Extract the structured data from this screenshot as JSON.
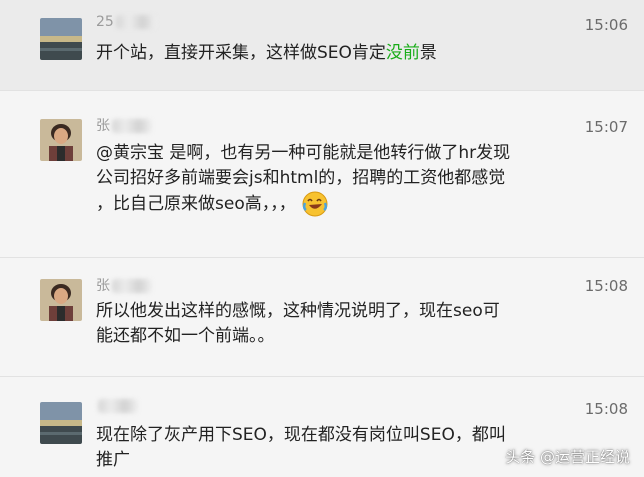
{
  "colors": {
    "highlight": "#1aad19",
    "text": "#222222",
    "meta": "#9b9b9b"
  },
  "messages": [
    {
      "sender_visible": "25",
      "time": "15:06",
      "avatar": "landscape-avatar",
      "text_a": "开个站，直接开采集，这样做SEO肯定",
      "text_highlight": "没前",
      "text_b": "景"
    },
    {
      "sender_visible": "张",
      "time": "15:07",
      "avatar": "person-avatar",
      "line1": "@黄宗宝 是啊，也有另一种可能就是他转行做了hr发现",
      "line2": "公司招好多前端要会js和html的，招聘的工资他都感觉",
      "line3": "，比自己原来做seo高，，，",
      "emoji": "laughing-crying-emoji"
    },
    {
      "sender_visible": "张",
      "time": "15:08",
      "avatar": "person-avatar",
      "line1": "所以他发出这样的感慨，这种情况说明了，现在seo可",
      "line2": "能还都不如一个前端。。"
    },
    {
      "sender_visible": "",
      "time": "15:08",
      "avatar": "landscape-avatar",
      "line1": "现在除了灰产用下SEO，现在都没有岗位叫SEO，都叫",
      "line2": "推广"
    }
  ],
  "watermark": "头条 @运营正经说"
}
